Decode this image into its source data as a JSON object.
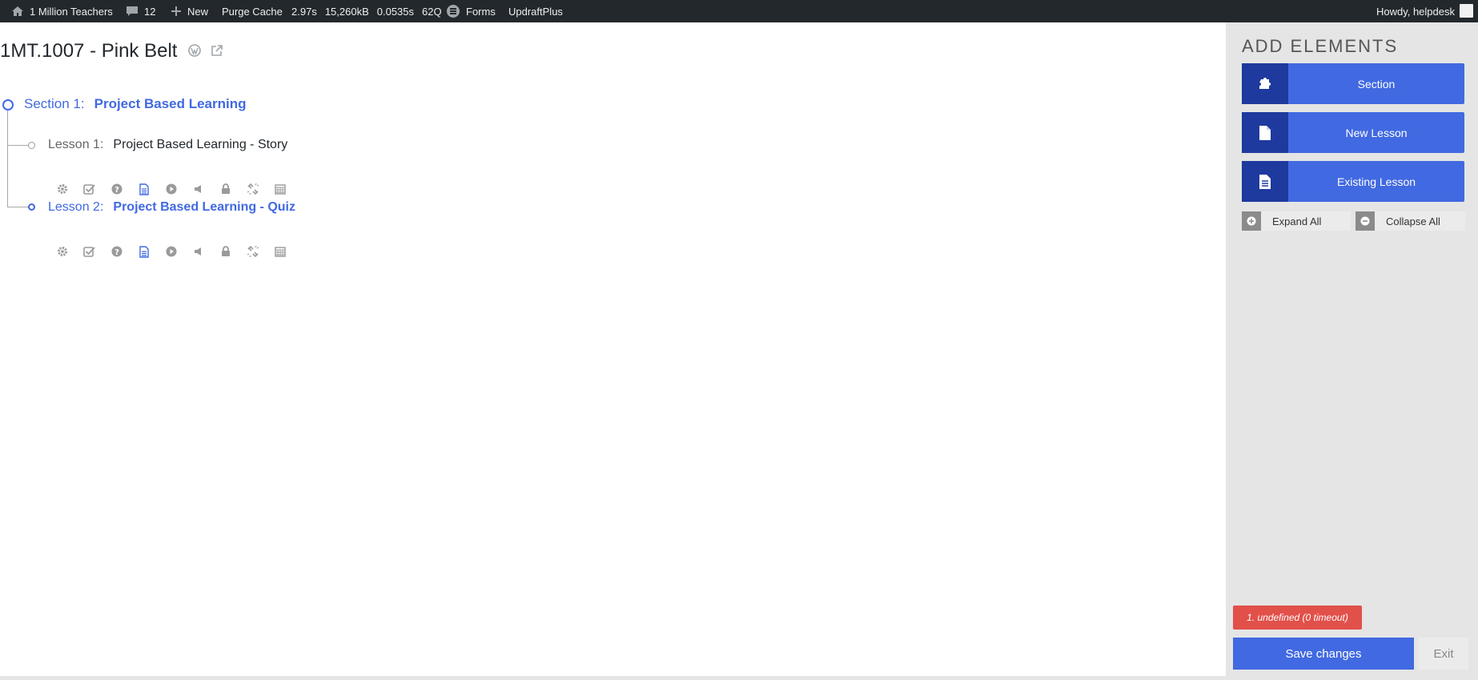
{
  "adminbar": {
    "site_name": "1 Million Teachers",
    "comments_count": "12",
    "new_label": "New",
    "purge_cache": "Purge Cache",
    "time": "2.97s",
    "memory": "15,260kB",
    "db_time": "0.0535s",
    "queries": "62Q",
    "forms": "Forms",
    "updraft": "UpdraftPlus",
    "howdy": "Howdy, helpdesk"
  },
  "course": {
    "title": "1MT.1007 - Pink Belt"
  },
  "section": {
    "number_label": "Section 1:",
    "name": "Project Based Learning"
  },
  "lessons": [
    {
      "number_label": "Lesson 1:",
      "name": "Project Based Learning - Story"
    },
    {
      "number_label": "Lesson 2:",
      "name": "Project Based Learning - Quiz"
    }
  ],
  "sidebar": {
    "title": "ADD ELEMENTS",
    "section_button": "Section",
    "new_lesson_button": "New Lesson",
    "existing_lesson_button": "Existing Lesson",
    "expand_all": "Expand All",
    "collapse_all": "Collapse All",
    "error_badge": "1. undefined (0 timeout)",
    "save_changes": "Save changes",
    "exit": "Exit"
  },
  "colors": {
    "accent": "#4169e1",
    "accent_dark": "#1e3a9e",
    "adminbar_bg": "#23282d",
    "error": "#e2504a",
    "sidebar_bg": "#e5e5e5"
  }
}
